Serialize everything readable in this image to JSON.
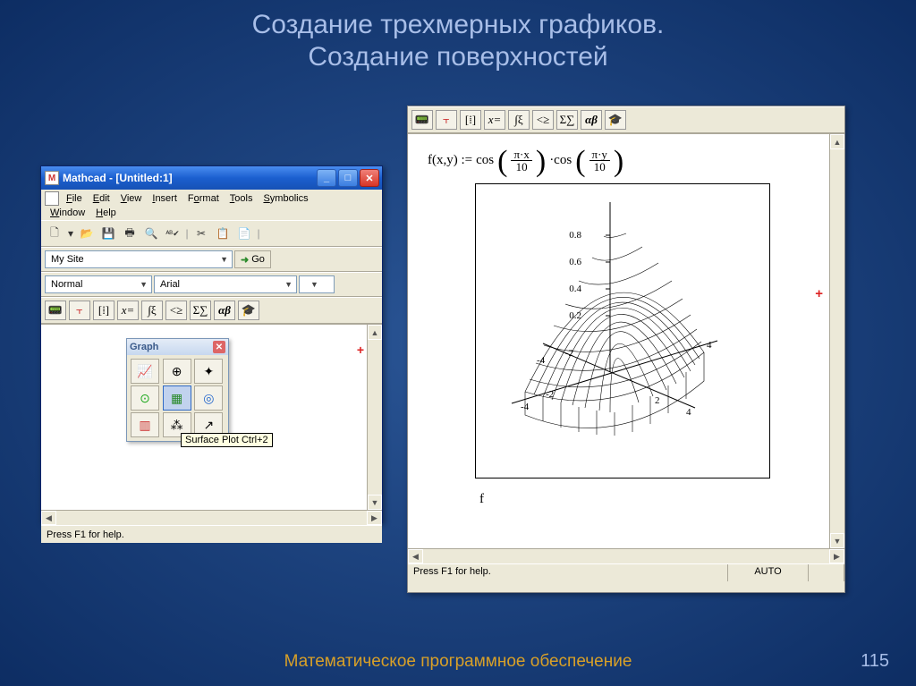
{
  "slide": {
    "title_line1": "Создание трехмерных графиков.",
    "title_line2": "Создание поверхностей",
    "footer": "Математическое программное обеспечение",
    "page": "115"
  },
  "left_window": {
    "title": "Mathcad - [Untitled:1]",
    "menu_row1": [
      "File",
      "Edit",
      "View",
      "Insert",
      "Format",
      "Tools",
      "Symbolics"
    ],
    "menu_row2": [
      "Window",
      "Help"
    ],
    "site_dropdown": "My Site",
    "go_label": "Go",
    "style_dropdown": "Normal",
    "font_dropdown": "Arial",
    "math_toolbar": [
      "📟",
      "⫟",
      "[⁞]",
      "x=",
      "∫ξ",
      "<≥",
      "Σ∑",
      "αβ",
      "🎓"
    ],
    "graph_palette_title": "Graph",
    "tooltip": "Surface Plot Ctrl+2",
    "status": "Press F1 for help."
  },
  "right_window": {
    "math_toolbar": [
      "📟",
      "⫟",
      "[⁞]",
      "x=",
      "∫ξ",
      "<≥",
      "Σ∑",
      "αβ",
      "🎓"
    ],
    "formula_lhs": "f(x,y) :=",
    "formula_fn1": "cos",
    "frac1_num": "π·x",
    "frac1_den": "10",
    "formula_fn2": "·cos",
    "frac2_num": "π·y",
    "frac2_den": "10",
    "plot_var": "f",
    "status": "Press F1 for help.",
    "auto": "AUTO"
  },
  "chart_data": {
    "type": "surface",
    "function": "f(x,y) = cos(pi*x/10) * cos(pi*y/10)",
    "x_range": [
      -4,
      4
    ],
    "y_range": [
      -4,
      4
    ],
    "z_range": [
      0,
      1
    ],
    "z_ticks": [
      0.2,
      0.4,
      0.6,
      0.8
    ],
    "x_ticks": [
      -4,
      -2,
      2,
      4
    ],
    "y_ticks": [
      -4,
      -2,
      2,
      4
    ],
    "style": "wireframe"
  }
}
